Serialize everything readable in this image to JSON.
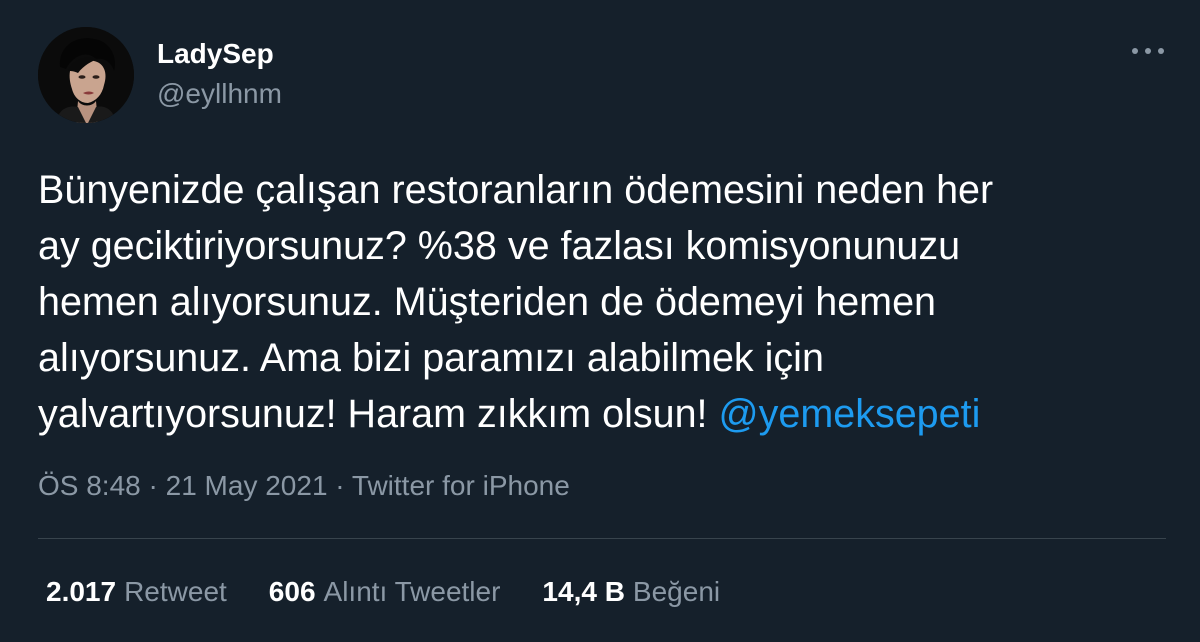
{
  "user": {
    "display_name": "LadySep",
    "handle": "@eyllhnm"
  },
  "tweet": {
    "text": "Bünyenizde çalışan restoranların ödemesini neden her\nay geciktiriyorsunuz? %38 ve fazlası komisyonunuzu\nhemen alıyorsunuz. Müşteriden de ödemeyi hemen\nalıyorsunuz. Ama bizi paramızı alabilmek için\nyalvartıyorsunuz! Haram zıkkım olsun! ",
    "mention": "@yemeksepeti",
    "time": "ÖS 8:48",
    "date": "21 May 2021",
    "source": "Twitter for iPhone",
    "separator": " · "
  },
  "stats": {
    "retweets_count": "2.017",
    "retweets_label": "Retweet",
    "quotes_count": "606",
    "quotes_label": "Alıntı Tweetler",
    "likes_count": "14,4 B",
    "likes_label": "Beğeni"
  },
  "icons": {
    "more": "more-dots-icon",
    "avatar": "user-avatar"
  },
  "colors": {
    "background": "#15202b",
    "text": "#ffffff",
    "secondary": "#8b98a5",
    "link": "#1d9bf0",
    "divider": "#38444d"
  }
}
